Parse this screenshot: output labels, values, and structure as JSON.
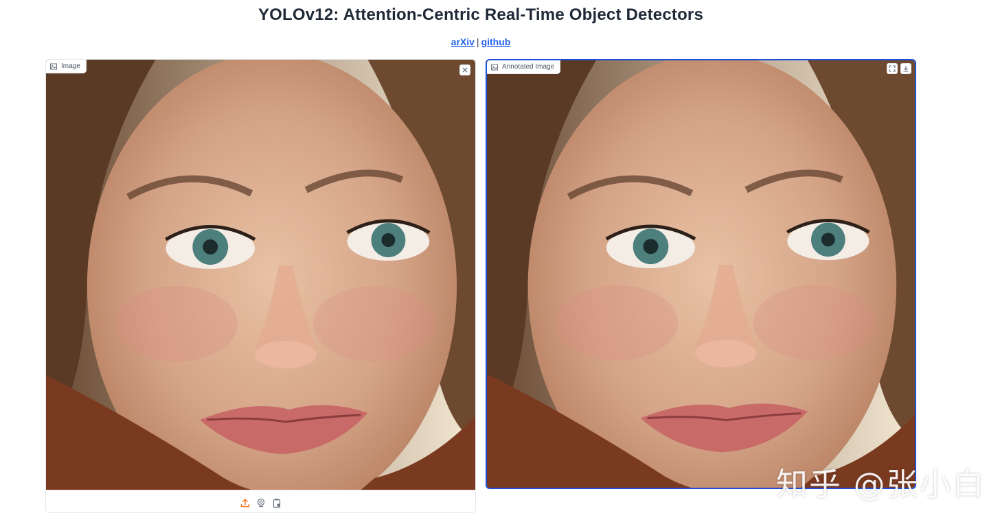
{
  "header": {
    "title": "YOLOv12: Attention-Centric Real-Time Object Detectors",
    "links": [
      {
        "label": "arXiv"
      },
      {
        "label": "github"
      }
    ],
    "separator": "|"
  },
  "input_panel": {
    "label": "Image",
    "label_icon": "image-icon",
    "clear_icon": "close-icon",
    "toolbar": [
      {
        "icon": "upload-icon"
      },
      {
        "icon": "webcam-icon"
      },
      {
        "icon": "clipboard-icon"
      }
    ]
  },
  "output_panel": {
    "label": "Annotated Image",
    "label_icon": "image-icon",
    "actions": [
      {
        "icon": "fullscreen-icon"
      },
      {
        "icon": "download-icon"
      }
    ]
  },
  "watermark": "知乎 @张小白",
  "colors": {
    "accent_blue": "#1d4ed8",
    "link": "#2563eb",
    "upload_orange": "#f97316"
  }
}
